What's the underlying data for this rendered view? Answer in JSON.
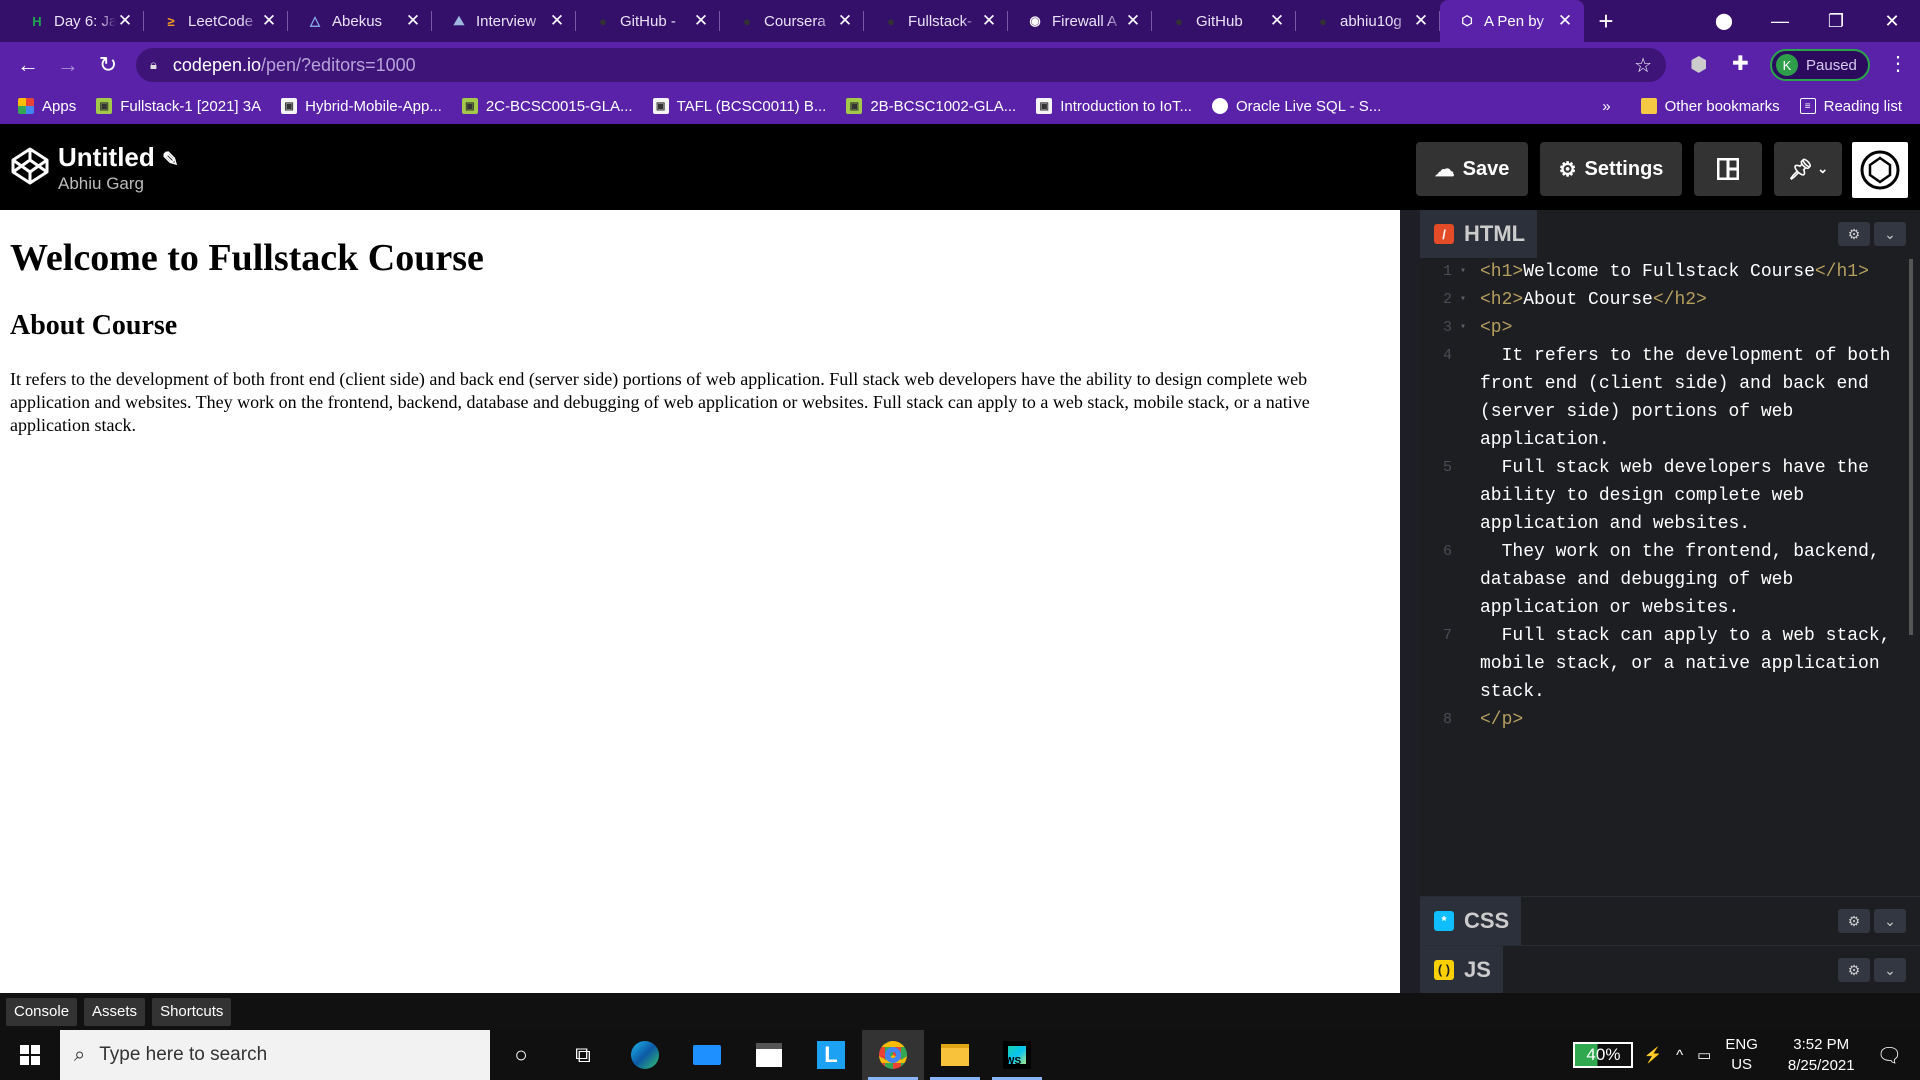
{
  "browser": {
    "tabs": [
      {
        "title": "Day 6: Jav",
        "icon": "hackerrank-icon"
      },
      {
        "title": "LeetCode",
        "icon": "leetcode-icon"
      },
      {
        "title": "Abekus",
        "icon": "abekus-icon"
      },
      {
        "title": "Interview",
        "icon": "interviewbit-icon"
      },
      {
        "title": "GitHub - ",
        "icon": "github-icon"
      },
      {
        "title": "Coursera",
        "icon": "github-icon"
      },
      {
        "title": "Fullstack-",
        "icon": "github-icon"
      },
      {
        "title": "Firewall A",
        "icon": "globe-icon"
      },
      {
        "title": "GitHub",
        "icon": "github-icon"
      },
      {
        "title": "abhiu10g",
        "icon": "github-icon"
      },
      {
        "title": "A Pen by",
        "icon": "codepen-icon",
        "active": true
      }
    ],
    "url_domain": "codepen.io",
    "url_path": "/pen/?editors=1000",
    "profile_initial": "K",
    "profile_status": "Paused",
    "bookmarks": [
      {
        "label": "Apps",
        "icon": "apps-grid-icon"
      },
      {
        "label": "Fullstack-1 [2021] 3A",
        "icon": "classroom-icon"
      },
      {
        "label": "Hybrid-Mobile-App...",
        "icon": "classroom-icon"
      },
      {
        "label": "2C-BCSC0015-GLA...",
        "icon": "classroom-icon"
      },
      {
        "label": "TAFL (BCSC0011) B...",
        "icon": "classroom-icon"
      },
      {
        "label": "2B-BCSC1002-GLA...",
        "icon": "classroom-icon"
      },
      {
        "label": "Introduction to IoT...",
        "icon": "classroom-icon"
      },
      {
        "label": "Oracle Live SQL - S...",
        "icon": "globe-icon"
      }
    ],
    "bookmarks_overflow": "»",
    "other_bookmarks": "Other bookmarks",
    "reading_list": "Reading list"
  },
  "codepen": {
    "pen_title": "Untitled",
    "author": "Abhiu Garg",
    "save_label": "Save",
    "settings_label": "Settings"
  },
  "preview": {
    "h1": "Welcome to Fullstack Course",
    "h2": "About Course",
    "p": "It refers to the development of both front end (client side) and back end (server side) portions of web application. Full stack web developers have the ability to design complete web application and websites. They work on the frontend, backend, database and debugging of web application or websites. Full stack can apply to a web stack, mobile stack, or a native application stack."
  },
  "editor": {
    "html_label": "HTML",
    "css_label": "CSS",
    "js_label": "JS",
    "lines": [
      {
        "n": "1",
        "open": "<h1>",
        "text": "Welcome to Fullstack Course",
        "close": "</h1>",
        "fold": "▾"
      },
      {
        "n": "2",
        "open": "<h2>",
        "text": "About Course",
        "close": "</h2>",
        "fold": "▾"
      },
      {
        "n": "3",
        "open": "<p>",
        "text": "",
        "close": "",
        "fold": "▾"
      },
      {
        "n": "4",
        "open": "",
        "text": "  It refers to the development of both front end (client side) and back end (server side) portions of web application.",
        "close": "",
        "fold": ""
      },
      {
        "n": "5",
        "open": "",
        "text": "  Full stack web developers have the ability to design complete web application and websites.",
        "close": "",
        "fold": ""
      },
      {
        "n": "6",
        "open": "",
        "text": "  They work on the frontend, backend, database and debugging of web application or websites.",
        "close": "",
        "fold": ""
      },
      {
        "n": "7",
        "open": "",
        "text": "  Full stack can apply to a web stack, mobile stack, or a native application stack.",
        "close": "",
        "fold": ""
      },
      {
        "n": "8",
        "open": "</p>",
        "text": "",
        "close": "",
        "fold": ""
      }
    ]
  },
  "footer": {
    "buttons": [
      "Console",
      "Assets",
      "Shortcuts"
    ]
  },
  "taskbar": {
    "search_placeholder": "Type here to search",
    "battery": "40%",
    "battery_level": 0.4,
    "lang": "ENG",
    "region": "US",
    "time": "3:52 PM",
    "date": "8/25/2021"
  },
  "colors": {
    "tabbar": "#35106b",
    "toolbar": "#5a22a8",
    "html_badge": "#e34c26",
    "css_badge": "#0ebeff",
    "js_badge": "#fcd000",
    "code_tag": "#b69e5f"
  }
}
